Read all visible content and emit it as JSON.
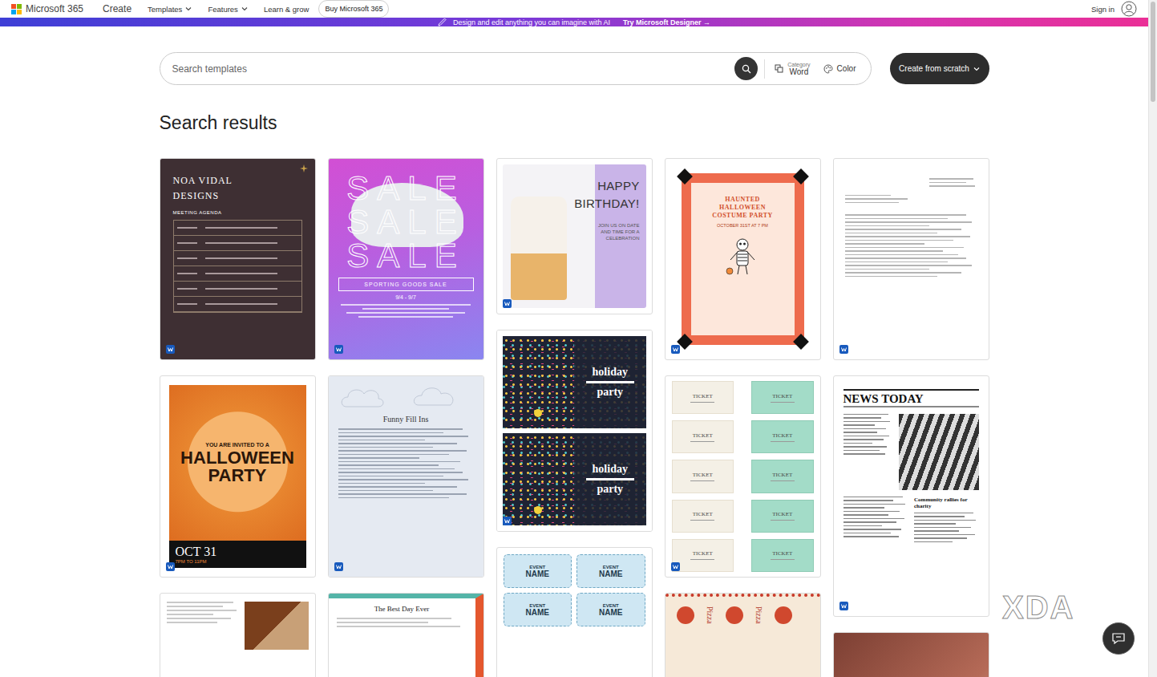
{
  "nav": {
    "brand": "Microsoft 365",
    "links": [
      {
        "label": "Create",
        "dropdown": false
      },
      {
        "label": "Templates",
        "dropdown": true
      },
      {
        "label": "Features",
        "dropdown": true
      },
      {
        "label": "Learn & grow",
        "dropdown": false
      }
    ],
    "buy": "Buy Microsoft 365",
    "sign_in": "Sign in"
  },
  "banner": {
    "text": "Design and edit anything you can imagine with AI",
    "link": "Try Microsoft Designer",
    "arrow": "→"
  },
  "search": {
    "placeholder": "Search templates",
    "category_label": "Category",
    "category": "Word",
    "color": "Color",
    "create": "Create from scratch"
  },
  "results": {
    "title": "Search results",
    "columns": [
      [
        {
          "kind": "agenda",
          "title": "NOA VIDAL DESIGNS",
          "subtitle": "MEETING AGENDA"
        },
        {
          "kind": "halloween",
          "invite": "YOU ARE INVITED TO A",
          "title": "HALLOWEEN PARTY",
          "date": "OCT 31",
          "time": "7PM TO 11PM"
        },
        {
          "kind": "brochure"
        }
      ],
      [
        {
          "kind": "sale",
          "words": [
            "SALE",
            "SALE",
            "SALE"
          ],
          "banner": "SPORTING GOODS SALE",
          "dates": "9/4 - 9/7"
        },
        {
          "kind": "fill-ins",
          "title": "Funny Fill Ins"
        },
        {
          "kind": "story",
          "title": "The Best Day Ever"
        }
      ],
      [
        {
          "kind": "birthday",
          "title": "HAPPY BIRTHDAY!",
          "subtitle": "JOIN US ON DATE AND TIME FOR A CELEBRATION"
        },
        {
          "kind": "holiday",
          "panels": [
            {
              "line1": "holiday",
              "line2": "party"
            },
            {
              "line1": "holiday",
              "line2": "party"
            }
          ]
        },
        {
          "kind": "name-tags",
          "tags": [
            {
              "line1": "EVENT",
              "line2": "NAME"
            },
            {
              "line1": "EVENT",
              "line2": "NAME"
            },
            {
              "line1": "EVENT",
              "line2": "NAME"
            },
            {
              "line1": "EVENT",
              "line2": "NAME"
            }
          ]
        }
      ],
      [
        {
          "kind": "costume",
          "title": "HAUNTED HALLOWEEN COSTUME PARTY",
          "date": "OCTOBER 31ST AT 7 PM"
        },
        {
          "kind": "tickets",
          "tickets": [
            "TICKET",
            "TICKET",
            "TICKET",
            "TICKET",
            "TICKET",
            "TICKET",
            "TICKET",
            "TICKET",
            "TICKET",
            "TICKET"
          ]
        },
        {
          "kind": "pizza",
          "title": "Pizza"
        }
      ],
      [
        {
          "kind": "letter"
        },
        {
          "kind": "newsletter",
          "title": "NEWS TODAY",
          "headline": "Community rallies for charity"
        },
        {
          "kind": "photo-card"
        }
      ]
    ]
  },
  "watermark": "XDA"
}
